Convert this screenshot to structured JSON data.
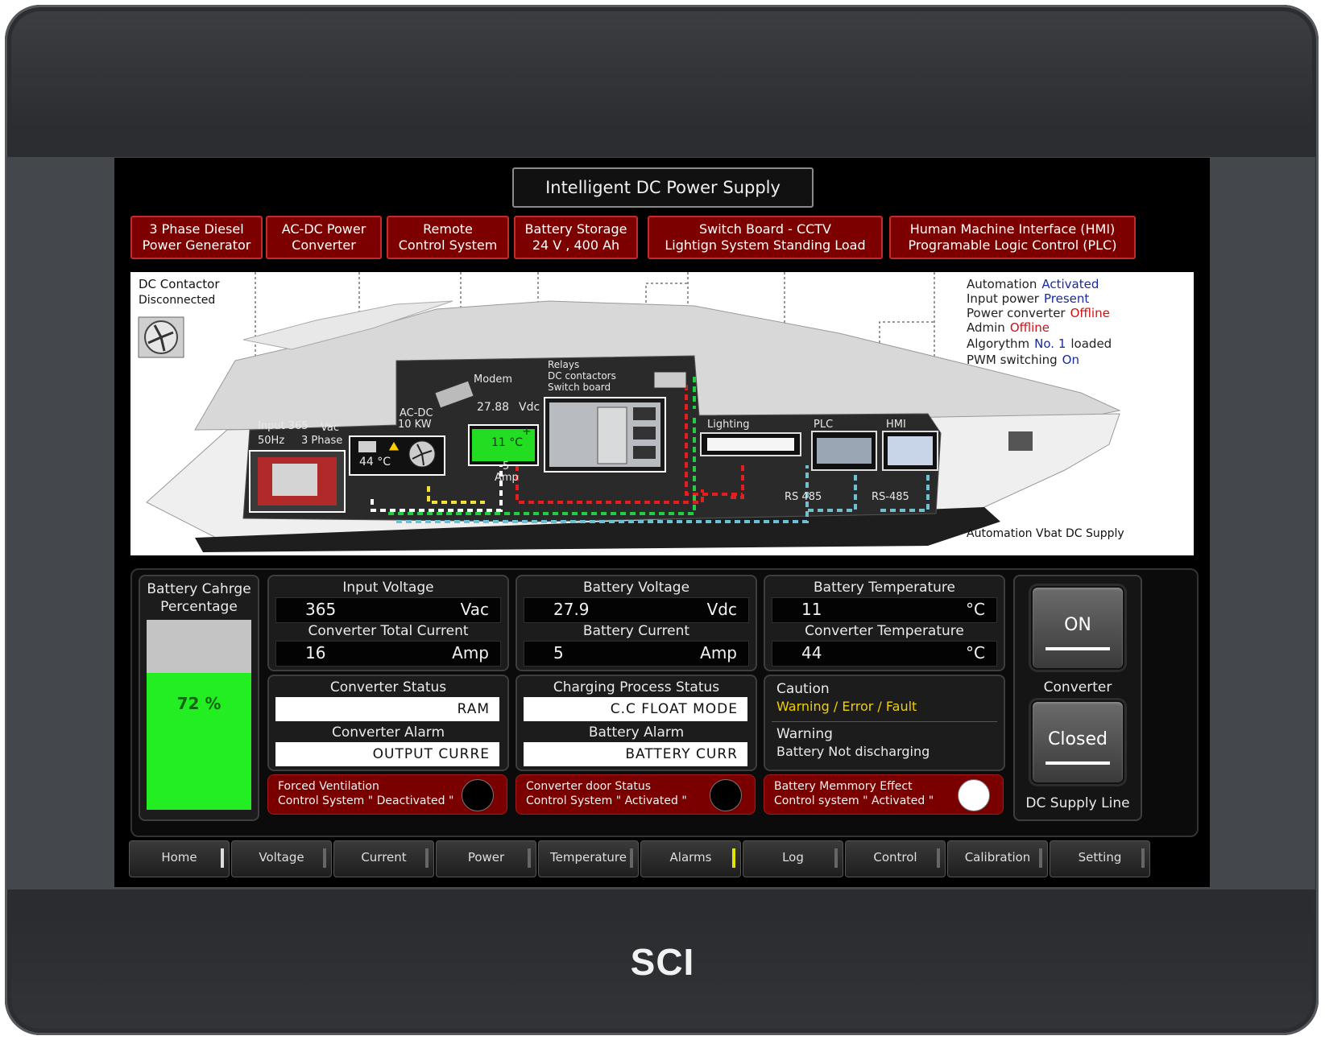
{
  "brand": "SCI",
  "title": "Intelligent DC Power Supply",
  "headers": [
    {
      "line1": "3 Phase Diesel",
      "line2": "Power Generator"
    },
    {
      "line1": "AC-DC Power",
      "line2": "Converter"
    },
    {
      "line1": "Remote",
      "line2": "Control System"
    },
    {
      "line1": "Battery Storage",
      "line2": "24 V , 400 Ah"
    },
    {
      "line1": "Switch Board - CCTV",
      "line2": "Lightign System Standing Load"
    },
    {
      "line1": "Human Machine Interface (HMI)",
      "line2": "Programable Logic Control (PLC)"
    }
  ],
  "diagram": {
    "contactor_line1": "DC Contactor",
    "contactor_line2": "Disconnected",
    "input_label": "Input 365",
    "input_unit": "Vac",
    "input_freq": "50Hz",
    "input_phase": "3 Phase",
    "acdc_line1": "AC-DC",
    "acdc_line2": "10 KW",
    "conv_temp": "44 °C",
    "modem": "Modem",
    "batt_volt": "27.88",
    "batt_volt_unit": "Vdc",
    "batt_temp": "11 °C",
    "batt_plus": "+",
    "batt_amp_value": "5",
    "batt_amp_unit": "Amp",
    "relays_line1": "Relays",
    "relays_line2": "DC contactors",
    "relays_line3": "Switch board",
    "lighting": "Lighting",
    "plc": "PLC",
    "hmi": "HMI",
    "rs485_a": "RS 485",
    "rs485_b": "RS-485",
    "footer": "Automation Vbat DC Supply",
    "status": [
      {
        "label": "Automation",
        "value": "Activated",
        "color": "#1a2a9a"
      },
      {
        "label": "Input power",
        "value": "Present",
        "color": "#1a2a9a"
      },
      {
        "label": "Power converter",
        "value": "Offline",
        "color": "#d01010"
      },
      {
        "label": "Admin",
        "value": "Offline",
        "color": "#d01010"
      },
      {
        "label": "Algorythm",
        "value": "No. 1",
        "suffix": "loaded",
        "color": "#1a2a9a"
      },
      {
        "label": "PWM switching",
        "value": "On",
        "color": "#1a2a9a"
      }
    ]
  },
  "battery": {
    "title1": "Battery Cahrge",
    "title2": "Percentage",
    "percent": 72,
    "label": "72 %"
  },
  "readings": {
    "input_voltage": {
      "title": "Input Voltage",
      "value": "365",
      "unit": "Vac"
    },
    "converter_current": {
      "title": "Converter Total Current",
      "value": "16",
      "unit": "Amp"
    },
    "battery_voltage": {
      "title": "Battery Voltage",
      "value": "27.9",
      "unit": "Vdc"
    },
    "battery_current": {
      "title": "Battery Current",
      "value": "5",
      "unit": "Amp"
    },
    "battery_temperature": {
      "title": "Battery Temperature",
      "value": "11",
      "unit": "°C"
    },
    "converter_temperature": {
      "title": "Converter Temperature",
      "value": "44",
      "unit": "°C"
    }
  },
  "statuses": {
    "converter_status": {
      "title": "Converter Status",
      "value": "RAM"
    },
    "converter_alarm": {
      "title": "Converter Alarm",
      "value": "OUTPUT CURRE"
    },
    "charging_status": {
      "title": "Charging Process Status",
      "value": "C.C FLOAT MODE"
    },
    "battery_alarm": {
      "title": "Battery Alarm",
      "value": "BATTERY CURR"
    }
  },
  "caution": {
    "caution_title": "Caution",
    "caution_text": "Warning / Error / Fault",
    "warning_title": "Warning",
    "warning_text": "Battery Not discharging"
  },
  "red_status": [
    {
      "line1": "Forced Ventilation",
      "line2": "Control System \" Deactivated \"",
      "indicator": "off"
    },
    {
      "line1": "Converter door Status",
      "line2": "Control System \" Activated \"",
      "indicator": "off"
    },
    {
      "line1": "Battery Memmory Effect",
      "line2": "Control system \" Activated \"",
      "indicator": "on"
    }
  ],
  "controls": {
    "converter_button": "ON",
    "converter_label": "Converter",
    "dc_button": "Closed",
    "dc_label": "DC Supply Line"
  },
  "nav": [
    "Home",
    "Voltage",
    "Current",
    "Power",
    "Temperature",
    "Alarms",
    "Log",
    "Control",
    "Calibration",
    "Setting"
  ],
  "colors": {
    "header_red": "#7c0000",
    "battery_green": "#22ee22",
    "caution_yellow": "#f0d000"
  }
}
